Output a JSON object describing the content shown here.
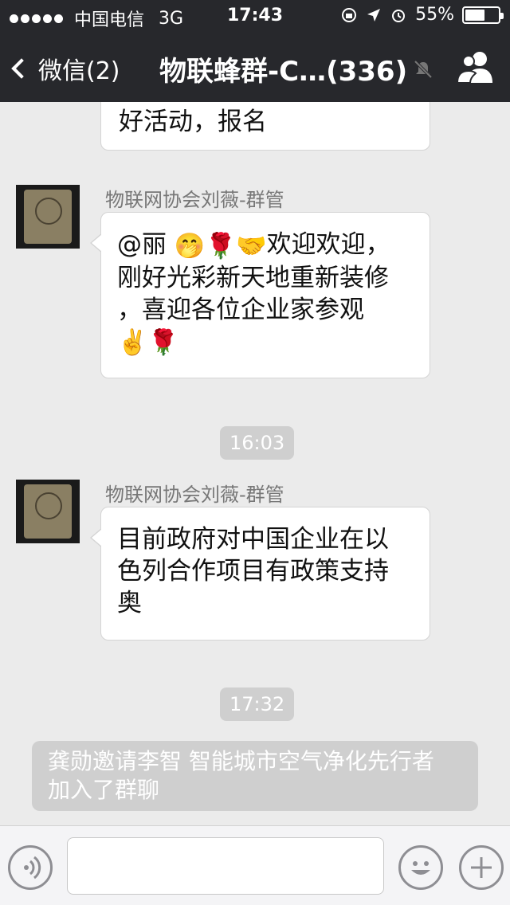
{
  "status": {
    "carrier": "中国电信",
    "network": "3G",
    "time": "17:43",
    "battery_text": "55%",
    "battery_level": 0.55
  },
  "nav": {
    "back_label": "微信(2)",
    "title": "物联蜂群-C…(336)"
  },
  "messages": [
    {
      "text": "好活动，报名"
    },
    {
      "sender": "物联网协会刘薇-群管",
      "text": "@丽 🤭🌹🤝欢迎欢迎，刚好光彩新天地重新装修，喜迎各位企业家参观✌️🌹",
      "lines": [
        "@丽 ",
        "刚好光彩新天地重新装修",
        "，喜迎各位企业家参观"
      ]
    },
    {
      "time": "16:03"
    },
    {
      "sender": "物联网协会刘薇-群管",
      "text": "目前政府对中国企业在以色列合作项目有政策支持奥",
      "lines": [
        "目前政府对中国企业在以",
        "色列合作项目有政策支持",
        "奥"
      ]
    },
    {
      "time": "17:32"
    },
    {
      "system": "龚勋邀请李智 智能城市空气净化先行者加入了群聊",
      "lines": [
        "龚勋邀请李智 智能城市空气净化先行者",
        "加入了群聊"
      ]
    }
  ],
  "emoji_line1_tail": "欢迎欢迎，",
  "input": {
    "placeholder": ""
  },
  "colors": {
    "bar": "#27282c",
    "chat_bg": "#ebebeb",
    "chip": "#cfcfcf"
  },
  "icons": [
    "back-chevron-icon",
    "mute-icon",
    "group-members-icon",
    "voice-icon",
    "emoji-face-icon",
    "plus-icon"
  ]
}
